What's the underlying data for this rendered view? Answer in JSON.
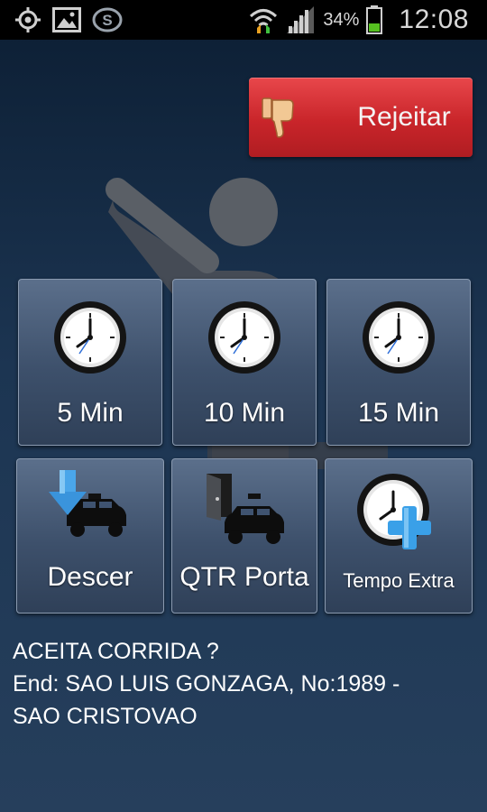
{
  "status_bar": {
    "icons_left": [
      "gps-icon",
      "gallery-icon",
      "app-notification-icon"
    ],
    "icons_right": [
      "wifi-icon",
      "signal-icon",
      "battery-icon"
    ],
    "battery_percent": "34%",
    "time": "12:08"
  },
  "reject": {
    "label": "Rejeitar",
    "icon": "thumbs-down-icon"
  },
  "tiles": [
    {
      "label": "5 Min",
      "icon": "clock-icon"
    },
    {
      "label": "10 Min",
      "icon": "clock-icon"
    },
    {
      "label": "15 Min",
      "icon": "clock-icon"
    },
    {
      "label": "Descer",
      "icon": "taxi-arrow-down-icon"
    },
    {
      "label": "QTR Porta",
      "icon": "taxi-door-icon"
    },
    {
      "label": "Tempo Extra",
      "icon": "clock-plus-icon"
    }
  ],
  "message": {
    "line1": "ACEITA CORRIDA  ?",
    "line2": "End: SAO LUIS GONZAGA, No:1989 -",
    "line3": "SAO CRISTOVAO"
  },
  "colors": {
    "reject_red": "#c9252a",
    "tile_blue": "#4a5d79",
    "background": "#1c3552",
    "plus_blue": "#3aa0e8"
  }
}
